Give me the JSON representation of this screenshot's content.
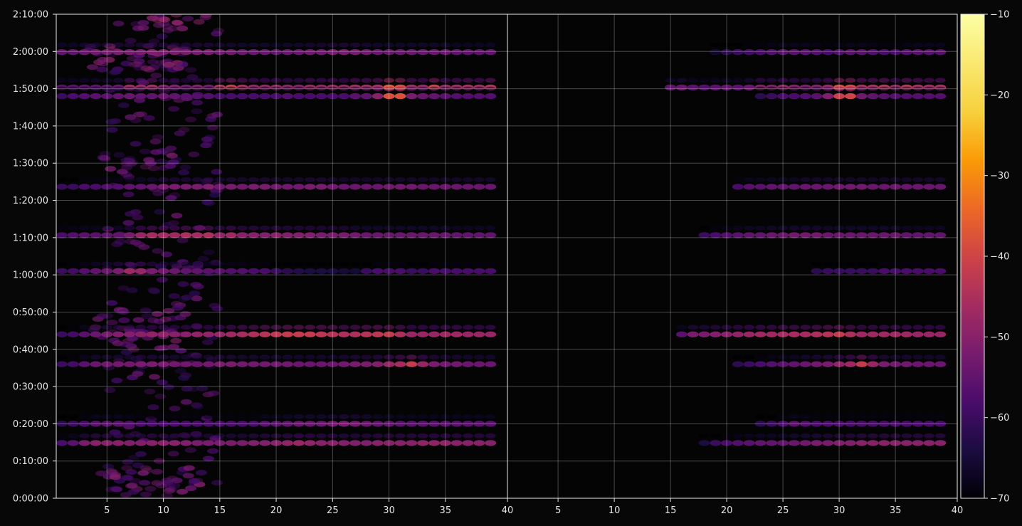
{
  "chart_data": {
    "type": "heatmap",
    "title": "",
    "xlabel": "",
    "ylabel": "",
    "panels": [
      {
        "name": "",
        "xlim": [
          1,
          40
        ],
        "x_ticks": [
          5,
          10,
          15,
          20,
          25,
          30,
          35,
          40
        ]
      },
      {
        "name": "",
        "xlim": [
          1,
          40
        ],
        "x_ticks": [
          5,
          10,
          15,
          20,
          25,
          30,
          35,
          40
        ]
      }
    ],
    "y_ticks": [
      "0:00:00",
      "0:10:00",
      "0:20:00",
      "0:30:00",
      "0:40:00",
      "0:50:00",
      "1:00:00",
      "1:10:00",
      "1:20:00",
      "1:30:00",
      "1:40:00",
      "1:50:00",
      "2:00:00",
      "2:10:00"
    ],
    "y_tick_seconds": [
      0,
      600,
      1200,
      1800,
      2400,
      3000,
      3600,
      4200,
      4800,
      5400,
      6000,
      6600,
      7200,
      7800
    ],
    "ylim_seconds": [
      0,
      7800
    ],
    "grid": true,
    "colormap": "inferno",
    "colorbar": {
      "range": [
        -70,
        -10
      ],
      "ticks": [
        "-10",
        "-20",
        "-30",
        "-40",
        "-50",
        "-60",
        "-70"
      ],
      "tick_values": [
        -10,
        -20,
        -30,
        -40,
        -50,
        -60,
        -70
      ]
    },
    "rows": [
      {
        "t": 7190,
        "panel1": [
          -55,
          -55,
          -54,
          -53,
          -52,
          -52,
          -52,
          -52,
          -51,
          -52,
          -52,
          -52,
          -52,
          -52,
          -53,
          -53,
          -54,
          -54,
          -54,
          -55,
          -54,
          -54,
          -53,
          -53,
          -52,
          -52,
          -52,
          -53,
          -54,
          -54,
          -54,
          -54,
          -54,
          -54,
          -54,
          -55,
          -55,
          -55,
          -55
        ],
        "panel2": [
          -70,
          -70,
          -70,
          -70,
          -70,
          -70,
          -70,
          -70,
          -70,
          -70,
          -70,
          -70,
          -70,
          -70,
          -70,
          -70,
          -70,
          -70,
          -66,
          -62,
          -60,
          -59,
          -58,
          -57,
          -56,
          -56,
          -56,
          -57,
          -58,
          -57,
          -56,
          -56,
          -57,
          -58,
          -58,
          -57,
          -56,
          -56,
          -56
        ]
      },
      {
        "t": 6620,
        "panel1": [
          -56,
          -56,
          -55,
          -55,
          -55,
          -54,
          -46,
          -47,
          -45,
          -50,
          -50,
          -52,
          -50,
          -52,
          -44,
          -41,
          -45,
          -48,
          -48,
          -48,
          -49,
          -50,
          -47,
          -48,
          -47,
          -48,
          -46,
          -46,
          -45,
          -36,
          -38,
          -46,
          -47,
          -40,
          -47,
          -46,
          -45,
          -46,
          -44
        ],
        "panel2": [
          -70,
          -70,
          -70,
          -70,
          -70,
          -70,
          -70,
          -70,
          -70,
          -70,
          -70,
          -70,
          -70,
          -70,
          -55,
          -54,
          -56,
          -57,
          -56,
          -55,
          -56,
          -54,
          -50,
          -51,
          -48,
          -50,
          -51,
          -50,
          -47,
          -38,
          -39,
          -45,
          -45,
          -43,
          -48,
          -43,
          -45,
          -46,
          -45
        ]
      },
      {
        "t": 6480,
        "panel1": [
          -60,
          -58,
          -57,
          -56,
          -56,
          -55,
          -54,
          -55,
          -55,
          -54,
          -55,
          -56,
          -57,
          -57,
          -58,
          -58,
          -58,
          -58,
          -58,
          -58,
          -57,
          -58,
          -58,
          -58,
          -58,
          -58,
          -56,
          -55,
          -50,
          -38,
          -38,
          -52,
          -54,
          -55,
          -56,
          -57,
          -57,
          -57,
          -57
        ],
        "panel2": [
          -70,
          -70,
          -70,
          -70,
          -70,
          -70,
          -70,
          -70,
          -70,
          -70,
          -70,
          -70,
          -70,
          -70,
          -70,
          -70,
          -70,
          -70,
          -70,
          -70,
          -70,
          -70,
          -62,
          -60,
          -58,
          -58,
          -57,
          -56,
          -51,
          -41,
          -40,
          -53,
          -55,
          -56,
          -57,
          -57,
          -57,
          -57,
          -57
        ]
      },
      {
        "t": 5020,
        "panel1": [
          -60,
          -60,
          -58,
          -58,
          -57,
          -57,
          -55,
          -55,
          -54,
          -52,
          -52,
          -52,
          -52,
          -51,
          -53,
          -52,
          -53,
          -52,
          -52,
          -53,
          -53,
          -53,
          -52,
          -52,
          -53,
          -54,
          -54,
          -54,
          -54,
          -53,
          -53,
          -53,
          -54,
          -54,
          -54,
          -54,
          -54,
          -54,
          -54
        ],
        "panel2": [
          -70,
          -70,
          -70,
          -70,
          -70,
          -70,
          -70,
          -70,
          -70,
          -70,
          -70,
          -70,
          -70,
          -70,
          -70,
          -70,
          -70,
          -70,
          -70,
          -70,
          -58,
          -56,
          -56,
          -55,
          -55,
          -55,
          -54,
          -54,
          -54,
          -53,
          -53,
          -53,
          -54,
          -54,
          -54,
          -54,
          -54,
          -54,
          -54
        ]
      },
      {
        "t": 4240,
        "panel1": [
          -58,
          -57,
          -56,
          -56,
          -55,
          -55,
          -52,
          -48,
          -46,
          -46,
          -47,
          -45,
          -46,
          -45,
          -49,
          -47,
          -50,
          -50,
          -51,
          -50,
          -51,
          -51,
          -51,
          -52,
          -52,
          -52,
          -53,
          -54,
          -54,
          -54,
          -54,
          -54,
          -54,
          -54,
          -54,
          -55,
          -55,
          -55,
          -55
        ],
        "panel2": [
          -70,
          -70,
          -70,
          -70,
          -70,
          -70,
          -70,
          -70,
          -70,
          -70,
          -70,
          -70,
          -70,
          -70,
          -70,
          -70,
          -70,
          -60,
          -58,
          -57,
          -56,
          -55,
          -55,
          -54,
          -54,
          -53,
          -53,
          -53,
          -54,
          -54,
          -54,
          -54,
          -54,
          -54,
          -54,
          -55,
          -55,
          -55,
          -55
        ]
      },
      {
        "t": 3660,
        "panel1": [
          -60,
          -59,
          -57,
          -55,
          -54,
          -52,
          -47,
          -48,
          -52,
          -53,
          -54,
          -55,
          -55,
          -56,
          -56,
          -57,
          -57,
          -58,
          -58,
          -60,
          -62,
          -63,
          -64,
          -64,
          -64,
          -65,
          -65,
          -60,
          -58,
          -58,
          -58,
          -60,
          -60,
          -58,
          -58,
          -58,
          -58,
          -58,
          -58
        ],
        "panel2": [
          -70,
          -70,
          -70,
          -70,
          -70,
          -70,
          -70,
          -70,
          -70,
          -70,
          -70,
          -70,
          -70,
          -70,
          -70,
          -70,
          -70,
          -70,
          -70,
          -70,
          -70,
          -70,
          -70,
          -70,
          -70,
          -70,
          -70,
          -62,
          -60,
          -60,
          -60,
          -60,
          -60,
          -58,
          -58,
          -58,
          -58,
          -58,
          -58
        ]
      },
      {
        "t": 2640,
        "panel1": [
          -60,
          -59,
          -56,
          -54,
          -52,
          -51,
          -51,
          -50,
          -49,
          -49,
          -50,
          -50,
          -49,
          -49,
          -48,
          -47,
          -46,
          -45,
          -44,
          -43,
          -42,
          -42,
          -42,
          -43,
          -44,
          -45,
          -45,
          -44,
          -43,
          -42,
          -45,
          -48,
          -48,
          -48,
          -47,
          -47,
          -48,
          -48,
          -48
        ],
        "panel2": [
          -70,
          -70,
          -70,
          -70,
          -70,
          -70,
          -70,
          -70,
          -70,
          -70,
          -70,
          -70,
          -70,
          -70,
          -70,
          -56,
          -52,
          -52,
          -51,
          -50,
          -49,
          -48,
          -47,
          -47,
          -46,
          -46,
          -46,
          -45,
          -44,
          -42,
          -45,
          -47,
          -47,
          -47,
          -47,
          -47,
          -48,
          -48,
          -48
        ]
      },
      {
        "t": 2160,
        "panel1": [
          -60,
          -59,
          -56,
          -54,
          -53,
          -53,
          -53,
          -52,
          -52,
          -52,
          -53,
          -53,
          -54,
          -53,
          -52,
          -52,
          -53,
          -53,
          -53,
          -53,
          -53,
          -54,
          -54,
          -54,
          -54,
          -53,
          -52,
          -52,
          -51,
          -48,
          -46,
          -42,
          -48,
          -52,
          -53,
          -53,
          -54,
          -54,
          -54
        ],
        "panel2": [
          -70,
          -70,
          -70,
          -70,
          -70,
          -70,
          -70,
          -70,
          -70,
          -70,
          -70,
          -70,
          -70,
          -70,
          -70,
          -70,
          -70,
          -70,
          -70,
          -70,
          -62,
          -60,
          -58,
          -57,
          -56,
          -55,
          -54,
          -53,
          -52,
          -49,
          -47,
          -42,
          -48,
          -52,
          -53,
          -53,
          -54,
          -54,
          -54
        ]
      },
      {
        "t": 1200,
        "panel1": [
          -62,
          -60,
          -58,
          -56,
          -56,
          -56,
          -57,
          -58,
          -58,
          -58,
          -58,
          -58,
          -58,
          -58,
          -58,
          -58,
          -58,
          -58,
          -56,
          -56,
          -55,
          -54,
          -54,
          -54,
          -53,
          -52,
          -53,
          -54,
          -55,
          -55,
          -56,
          -56,
          -56,
          -56,
          -56,
          -56,
          -56,
          -56,
          -56
        ],
        "panel2": [
          -70,
          -70,
          -70,
          -70,
          -70,
          -70,
          -70,
          -70,
          -70,
          -70,
          -70,
          -70,
          -70,
          -70,
          -70,
          -70,
          -70,
          -70,
          -70,
          -70,
          -70,
          -70,
          -62,
          -60,
          -58,
          -56,
          -57,
          -58,
          -58,
          -58,
          -58,
          -58,
          -58,
          -58,
          -58,
          -58,
          -58,
          -58,
          -58
        ]
      },
      {
        "t": 890,
        "panel1": [
          -58,
          -56,
          -52,
          -50,
          -50,
          -50,
          -51,
          -51,
          -50,
          -50,
          -50,
          -51,
          -52,
          -52,
          -52,
          -52,
          -52,
          -51,
          -51,
          -50,
          -49,
          -48,
          -49,
          -50,
          -50,
          -51,
          -51,
          -51,
          -50,
          -50,
          -50,
          -50,
          -49,
          -49,
          -49,
          -50,
          -50,
          -50,
          -50
        ],
        "panel2": [
          -70,
          -70,
          -70,
          -70,
          -70,
          -70,
          -70,
          -70,
          -70,
          -70,
          -70,
          -70,
          -70,
          -70,
          -70,
          -70,
          -70,
          -64,
          -60,
          -58,
          -57,
          -56,
          -55,
          -55,
          -55,
          -54,
          -53,
          -52,
          -52,
          -51,
          -51,
          -50,
          -50,
          -50,
          -50,
          -50,
          -50,
          -50,
          -50
        ]
      }
    ],
    "clusters": [
      {
        "t0": 0,
        "t1": 7800,
        "x0": 5,
        "x1": 15,
        "value": -58,
        "count": 260
      },
      {
        "t0": 7550,
        "t1": 7800,
        "x0": 7,
        "x1": 14,
        "value": -52,
        "count": 20
      },
      {
        "t0": 6900,
        "t1": 7300,
        "x0": 3,
        "x1": 12,
        "value": -53,
        "count": 35
      },
      {
        "t0": 5300,
        "t1": 5600,
        "x0": 4,
        "x1": 11,
        "value": -56,
        "count": 25
      },
      {
        "t0": 2400,
        "t1": 3100,
        "x0": 3,
        "x1": 12,
        "value": -55,
        "count": 40
      },
      {
        "t0": 100,
        "t1": 500,
        "x0": 4,
        "x1": 14,
        "value": -55,
        "count": 35
      }
    ]
  }
}
